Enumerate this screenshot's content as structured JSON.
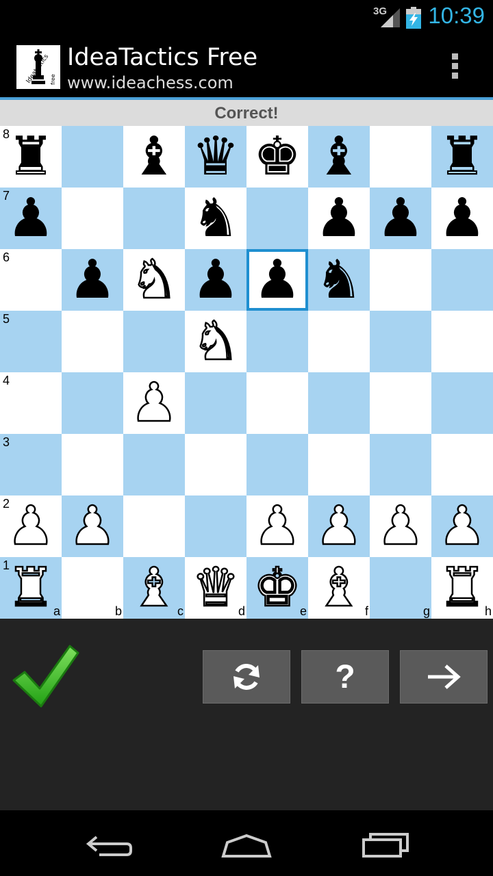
{
  "status_bar": {
    "network": "3G",
    "time": "10:39"
  },
  "app": {
    "title": "IdeaTactics Free",
    "subtitle": "www.ideachess.com",
    "logo_text": "Ideatactics free"
  },
  "result": {
    "message": "Correct!"
  },
  "board": {
    "rank_labels": [
      "8",
      "7",
      "6",
      "5",
      "4",
      "3",
      "2",
      "1"
    ],
    "file_labels": [
      "a",
      "b",
      "c",
      "d",
      "e",
      "f",
      "g",
      "h"
    ],
    "selected_square": "e6",
    "ranks": [
      [
        "black-rook",
        "",
        "black-bishop",
        "black-queen",
        "black-king",
        "black-bishop",
        "",
        "black-rook"
      ],
      [
        "black-pawn",
        "",
        "",
        "black-knight",
        "",
        "black-pawn",
        "black-pawn",
        "black-pawn"
      ],
      [
        "",
        "black-pawn",
        "white-knight",
        "black-pawn",
        "black-pawn",
        "black-knight",
        "",
        ""
      ],
      [
        "",
        "",
        "",
        "white-knight",
        "",
        "",
        "",
        ""
      ],
      [
        "",
        "",
        "white-pawn",
        "",
        "",
        "",
        "",
        ""
      ],
      [
        "",
        "",
        "",
        "",
        "",
        "",
        "",
        ""
      ],
      [
        "white-pawn",
        "white-pawn",
        "",
        "",
        "white-pawn",
        "white-pawn",
        "white-pawn",
        "white-pawn"
      ],
      [
        "white-rook",
        "",
        "white-bishop",
        "white-queen",
        "white-king",
        "white-bishop",
        "",
        "white-rook"
      ]
    ]
  },
  "controls": {
    "result_icon": "checkmark-icon",
    "buttons": [
      {
        "name": "refresh-button",
        "icon": "refresh-icon"
      },
      {
        "name": "hint-button",
        "icon": "question-icon"
      },
      {
        "name": "next-button",
        "icon": "arrow-right-icon"
      }
    ],
    "hint_symbol": "?"
  },
  "colors": {
    "light_square": "#ffffff",
    "dark_square": "#a7d3f1",
    "selection": "#1f8fd0",
    "accent": "#33b5e5",
    "check_green": "#3cbf2c"
  },
  "nav": {
    "buttons": [
      "back-icon",
      "home-icon",
      "recent-apps-icon"
    ]
  }
}
